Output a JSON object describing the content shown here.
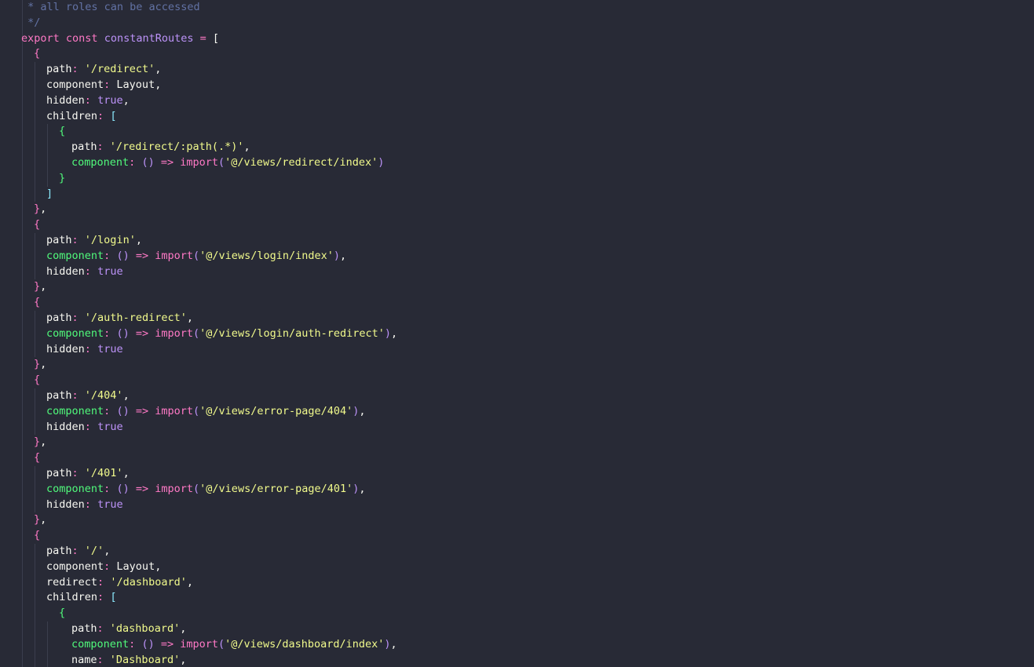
{
  "editor": {
    "language": "javascript",
    "theme": {
      "background": "#282a36",
      "keyword": "#ff79c6",
      "string": "#f1fa8c",
      "identifier": "#bd93f9",
      "function_property": "#50fa7b",
      "comment": "#6272a4",
      "bracket_level_1": "#ff79c6",
      "bracket_level_2": "#8be9fd",
      "bracket_level_3": "#50fa7b",
      "plain": "#f8f8f2"
    },
    "lines": [
      {
        "indent": 0,
        "tokens": [
          [
            "cm",
            " * all roles can be accessed"
          ]
        ]
      },
      {
        "indent": 0,
        "tokens": [
          [
            "cm",
            " */"
          ]
        ]
      },
      {
        "indent": 0,
        "tokens": [
          [
            "kw",
            "export"
          ],
          [
            "pn",
            " "
          ],
          [
            "kw",
            "const"
          ],
          [
            "pn",
            " "
          ],
          [
            "def",
            "constantRoutes"
          ],
          [
            "pn",
            " "
          ],
          [
            "op",
            "="
          ],
          [
            "pn",
            " "
          ],
          [
            "pn",
            "["
          ]
        ]
      },
      {
        "indent": 1,
        "tokens": [
          [
            "b1",
            "{"
          ]
        ]
      },
      {
        "indent": 2,
        "tokens": [
          [
            "prop",
            "path"
          ],
          [
            "op",
            ":"
          ],
          [
            "pn",
            " "
          ],
          [
            "str",
            "'/redirect'"
          ],
          [
            "pn",
            ","
          ]
        ]
      },
      {
        "indent": 2,
        "tokens": [
          [
            "prop",
            "component"
          ],
          [
            "op",
            ":"
          ],
          [
            "pn",
            " Layout,"
          ]
        ]
      },
      {
        "indent": 2,
        "tokens": [
          [
            "prop",
            "hidden"
          ],
          [
            "op",
            ":"
          ],
          [
            "pn",
            " "
          ],
          [
            "bool",
            "true"
          ],
          [
            "pn",
            ","
          ]
        ]
      },
      {
        "indent": 2,
        "tokens": [
          [
            "prop",
            "children"
          ],
          [
            "op",
            ":"
          ],
          [
            "pn",
            " "
          ],
          [
            "b2",
            "["
          ]
        ]
      },
      {
        "indent": 3,
        "tokens": [
          [
            "b3",
            "{"
          ]
        ]
      },
      {
        "indent": 4,
        "tokens": [
          [
            "prop",
            "path"
          ],
          [
            "op",
            ":"
          ],
          [
            "pn",
            " "
          ],
          [
            "str",
            "'/redirect/:path(.*)'"
          ],
          [
            "pn",
            ","
          ]
        ]
      },
      {
        "indent": 4,
        "tokens": [
          [
            "fnprop",
            "component"
          ],
          [
            "op",
            ":"
          ],
          [
            "pn",
            " "
          ],
          [
            "pi",
            "()"
          ],
          [
            "pn",
            " "
          ],
          [
            "op",
            "=>"
          ],
          [
            "pn",
            " "
          ],
          [
            "kw",
            "import"
          ],
          [
            "pi",
            "("
          ],
          [
            "str",
            "'@/views/redirect/index'"
          ],
          [
            "pi",
            ")"
          ]
        ]
      },
      {
        "indent": 3,
        "tokens": [
          [
            "b3",
            "}"
          ]
        ]
      },
      {
        "indent": 2,
        "tokens": [
          [
            "b2",
            "]"
          ]
        ]
      },
      {
        "indent": 1,
        "tokens": [
          [
            "b1",
            "}"
          ],
          [
            "pn",
            ","
          ]
        ]
      },
      {
        "indent": 1,
        "tokens": [
          [
            "b1",
            "{"
          ]
        ]
      },
      {
        "indent": 2,
        "tokens": [
          [
            "prop",
            "path"
          ],
          [
            "op",
            ":"
          ],
          [
            "pn",
            " "
          ],
          [
            "str",
            "'/login'"
          ],
          [
            "pn",
            ","
          ]
        ]
      },
      {
        "indent": 2,
        "tokens": [
          [
            "fnprop",
            "component"
          ],
          [
            "op",
            ":"
          ],
          [
            "pn",
            " "
          ],
          [
            "pi",
            "()"
          ],
          [
            "pn",
            " "
          ],
          [
            "op",
            "=>"
          ],
          [
            "pn",
            " "
          ],
          [
            "kw",
            "import"
          ],
          [
            "pi",
            "("
          ],
          [
            "str",
            "'@/views/login/index'"
          ],
          [
            "pi",
            ")"
          ],
          [
            "pn",
            ","
          ]
        ]
      },
      {
        "indent": 2,
        "tokens": [
          [
            "prop",
            "hidden"
          ],
          [
            "op",
            ":"
          ],
          [
            "pn",
            " "
          ],
          [
            "bool",
            "true"
          ]
        ]
      },
      {
        "indent": 1,
        "tokens": [
          [
            "b1",
            "}"
          ],
          [
            "pn",
            ","
          ]
        ]
      },
      {
        "indent": 1,
        "tokens": [
          [
            "b1",
            "{"
          ]
        ]
      },
      {
        "indent": 2,
        "tokens": [
          [
            "prop",
            "path"
          ],
          [
            "op",
            ":"
          ],
          [
            "pn",
            " "
          ],
          [
            "str",
            "'/auth-redirect'"
          ],
          [
            "pn",
            ","
          ]
        ]
      },
      {
        "indent": 2,
        "tokens": [
          [
            "fnprop",
            "component"
          ],
          [
            "op",
            ":"
          ],
          [
            "pn",
            " "
          ],
          [
            "pi",
            "()"
          ],
          [
            "pn",
            " "
          ],
          [
            "op",
            "=>"
          ],
          [
            "pn",
            " "
          ],
          [
            "kw",
            "import"
          ],
          [
            "pi",
            "("
          ],
          [
            "str",
            "'@/views/login/auth-redirect'"
          ],
          [
            "pi",
            ")"
          ],
          [
            "pn",
            ","
          ]
        ]
      },
      {
        "indent": 2,
        "tokens": [
          [
            "prop",
            "hidden"
          ],
          [
            "op",
            ":"
          ],
          [
            "pn",
            " "
          ],
          [
            "bool",
            "true"
          ]
        ]
      },
      {
        "indent": 1,
        "tokens": [
          [
            "b1",
            "}"
          ],
          [
            "pn",
            ","
          ]
        ]
      },
      {
        "indent": 1,
        "tokens": [
          [
            "b1",
            "{"
          ]
        ]
      },
      {
        "indent": 2,
        "tokens": [
          [
            "prop",
            "path"
          ],
          [
            "op",
            ":"
          ],
          [
            "pn",
            " "
          ],
          [
            "str",
            "'/404'"
          ],
          [
            "pn",
            ","
          ]
        ]
      },
      {
        "indent": 2,
        "tokens": [
          [
            "fnprop",
            "component"
          ],
          [
            "op",
            ":"
          ],
          [
            "pn",
            " "
          ],
          [
            "pi",
            "()"
          ],
          [
            "pn",
            " "
          ],
          [
            "op",
            "=>"
          ],
          [
            "pn",
            " "
          ],
          [
            "kw",
            "import"
          ],
          [
            "pi",
            "("
          ],
          [
            "str",
            "'@/views/error-page/404'"
          ],
          [
            "pi",
            ")"
          ],
          [
            "pn",
            ","
          ]
        ]
      },
      {
        "indent": 2,
        "tokens": [
          [
            "prop",
            "hidden"
          ],
          [
            "op",
            ":"
          ],
          [
            "pn",
            " "
          ],
          [
            "bool",
            "true"
          ]
        ]
      },
      {
        "indent": 1,
        "tokens": [
          [
            "b1",
            "}"
          ],
          [
            "pn",
            ","
          ]
        ]
      },
      {
        "indent": 1,
        "tokens": [
          [
            "b1",
            "{"
          ]
        ]
      },
      {
        "indent": 2,
        "tokens": [
          [
            "prop",
            "path"
          ],
          [
            "op",
            ":"
          ],
          [
            "pn",
            " "
          ],
          [
            "str",
            "'/401'"
          ],
          [
            "pn",
            ","
          ]
        ]
      },
      {
        "indent": 2,
        "tokens": [
          [
            "fnprop",
            "component"
          ],
          [
            "op",
            ":"
          ],
          [
            "pn",
            " "
          ],
          [
            "pi",
            "()"
          ],
          [
            "pn",
            " "
          ],
          [
            "op",
            "=>"
          ],
          [
            "pn",
            " "
          ],
          [
            "kw",
            "import"
          ],
          [
            "pi",
            "("
          ],
          [
            "str",
            "'@/views/error-page/401'"
          ],
          [
            "pi",
            ")"
          ],
          [
            "pn",
            ","
          ]
        ]
      },
      {
        "indent": 2,
        "tokens": [
          [
            "prop",
            "hidden"
          ],
          [
            "op",
            ":"
          ],
          [
            "pn",
            " "
          ],
          [
            "bool",
            "true"
          ]
        ]
      },
      {
        "indent": 1,
        "tokens": [
          [
            "b1",
            "}"
          ],
          [
            "pn",
            ","
          ]
        ]
      },
      {
        "indent": 1,
        "tokens": [
          [
            "b1",
            "{"
          ]
        ]
      },
      {
        "indent": 2,
        "tokens": [
          [
            "prop",
            "path"
          ],
          [
            "op",
            ":"
          ],
          [
            "pn",
            " "
          ],
          [
            "str",
            "'/'"
          ],
          [
            "pn",
            ","
          ]
        ]
      },
      {
        "indent": 2,
        "tokens": [
          [
            "prop",
            "component"
          ],
          [
            "op",
            ":"
          ],
          [
            "pn",
            " Layout,"
          ]
        ]
      },
      {
        "indent": 2,
        "tokens": [
          [
            "prop",
            "redirect"
          ],
          [
            "op",
            ":"
          ],
          [
            "pn",
            " "
          ],
          [
            "str",
            "'/dashboard'"
          ],
          [
            "pn",
            ","
          ]
        ]
      },
      {
        "indent": 2,
        "tokens": [
          [
            "prop",
            "children"
          ],
          [
            "op",
            ":"
          ],
          [
            "pn",
            " "
          ],
          [
            "b2",
            "["
          ]
        ]
      },
      {
        "indent": 3,
        "tokens": [
          [
            "b3",
            "{"
          ]
        ]
      },
      {
        "indent": 4,
        "tokens": [
          [
            "prop",
            "path"
          ],
          [
            "op",
            ":"
          ],
          [
            "pn",
            " "
          ],
          [
            "str",
            "'dashboard'"
          ],
          [
            "pn",
            ","
          ]
        ]
      },
      {
        "indent": 4,
        "tokens": [
          [
            "fnprop",
            "component"
          ],
          [
            "op",
            ":"
          ],
          [
            "pn",
            " "
          ],
          [
            "pi",
            "()"
          ],
          [
            "pn",
            " "
          ],
          [
            "op",
            "=>"
          ],
          [
            "pn",
            " "
          ],
          [
            "kw",
            "import"
          ],
          [
            "pi",
            "("
          ],
          [
            "str",
            "'@/views/dashboard/index'"
          ],
          [
            "pi",
            ")"
          ],
          [
            "pn",
            ","
          ]
        ]
      },
      {
        "indent": 4,
        "tokens": [
          [
            "prop",
            "name"
          ],
          [
            "op",
            ":"
          ],
          [
            "pn",
            " "
          ],
          [
            "str",
            "'Dashboard'"
          ],
          [
            "pn",
            ","
          ]
        ]
      }
    ]
  }
}
